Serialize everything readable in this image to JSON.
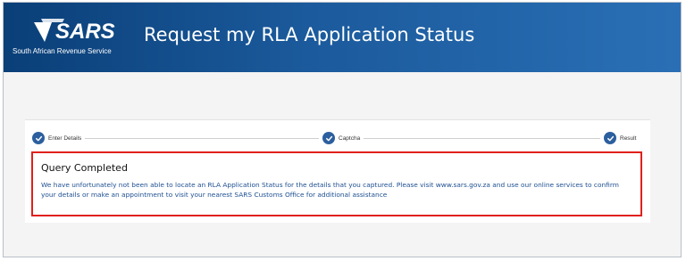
{
  "header": {
    "logo_text": "SARS",
    "logo_subtitle": "South African Revenue Service",
    "title": "Request my RLA Application Status",
    "background": "#1b5a9c"
  },
  "stepper": {
    "steps": [
      {
        "label": "Enter Details",
        "completed": true
      },
      {
        "label": "Captcha",
        "completed": true
      },
      {
        "label": "Result",
        "completed": true
      }
    ],
    "accent": "#2c5f9e"
  },
  "result": {
    "title": "Query Completed",
    "message": "We have unfortunately not been able to locate an RLA Application Status for the details that you captured.  Please visit www.sars.gov.za and use our online services to confirm your details or make an appointment to visit your nearest SARS Customs Office for additional assistance",
    "highlight_color": "#e0201c",
    "message_color": "#1d4f91"
  }
}
